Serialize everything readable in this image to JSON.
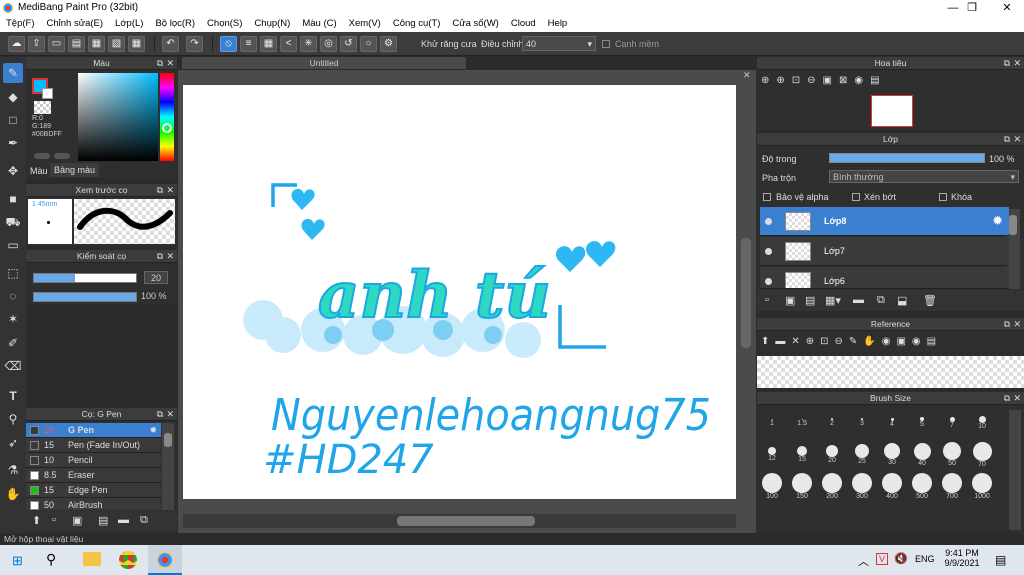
{
  "window": {
    "title": "MediBang Paint Pro (32bit)",
    "min": "—",
    "max": "❐",
    "close": "✕"
  },
  "menu": [
    "Tệp(F)",
    "Chỉnh sửa(E)",
    "Lớp(L)",
    "Bộ lọc(R)",
    "Chọn(S)",
    "Chụp(N)",
    "Màu (C)",
    "Xem(V)",
    "Công cụ(T)",
    "Cửa sổ(W)",
    "Cloud",
    "Help"
  ],
  "toolbar": {
    "antialias_label": "Khử răng cưa",
    "adjust_label": "Điều chỉnh",
    "adjust_value": "40",
    "soft_edge_label": "Cạnh mềm"
  },
  "color_panel": {
    "title": "Màu",
    "r": "R:0",
    "g": "G:189",
    "b": "B:255",
    "hex": "#00BDFF",
    "tab_color": "Màu",
    "tab_palette": "Bảng màu",
    "primary": "#00bdff"
  },
  "preview_panel": {
    "title": "Xem trước cọ",
    "size": "1.45mm"
  },
  "brush_control": {
    "title": "Kiểm soát cọ",
    "size_value": "20",
    "opacity_value": "100 %"
  },
  "brush_list": {
    "title": "Cọ: G Pen",
    "items": [
      {
        "size": "20",
        "name": "G Pen",
        "color": "#3a3a3a"
      },
      {
        "size": "15",
        "name": "Pen (Fade In/Out)",
        "color": "#3a3a3a"
      },
      {
        "size": "10",
        "name": "Pencil",
        "color": "#3a3a3a"
      },
      {
        "size": "8.5",
        "name": "Eraser",
        "color": "#ffffff"
      },
      {
        "size": "15",
        "name": "Edge Pen",
        "color": "#22bb22"
      },
      {
        "size": "50",
        "name": "AirBrush",
        "color": "#ffffff"
      }
    ]
  },
  "canvas": {
    "doc_title": "Untitled"
  },
  "navigator": {
    "title": "Hoa tiêu"
  },
  "layers": {
    "title": "Lớp",
    "opacity_label": "Độ trong",
    "opacity_value": "100 %",
    "blend_label": "Pha trộn",
    "blend_value": "Bình thường",
    "protect_alpha": "Bảo vệ alpha",
    "clipping": "Xén bớt",
    "lock": "Khóa",
    "items": [
      {
        "name": "Lớp8"
      },
      {
        "name": "Lớp7"
      },
      {
        "name": "Lớp6"
      }
    ]
  },
  "reference": {
    "title": "Reference"
  },
  "brush_size": {
    "title": "Brush Size",
    "sizes": [
      "1",
      "1.5",
      "2",
      "3",
      "4",
      "5",
      "7",
      "10",
      "12",
      "15",
      "20",
      "25",
      "30",
      "40",
      "50",
      "70",
      "100",
      "150",
      "200",
      "300",
      "400",
      "500",
      "700",
      "1000"
    ]
  },
  "status": {
    "text": "Mở hộp thoại vật liệu"
  },
  "taskbar": {
    "lang": "ENG",
    "time": "9:41 PM",
    "date": "9/9/2021"
  },
  "artwork": {
    "title": "anh tú",
    "line1": "Nguyenlehoangnug75",
    "line2": "#HD247"
  }
}
